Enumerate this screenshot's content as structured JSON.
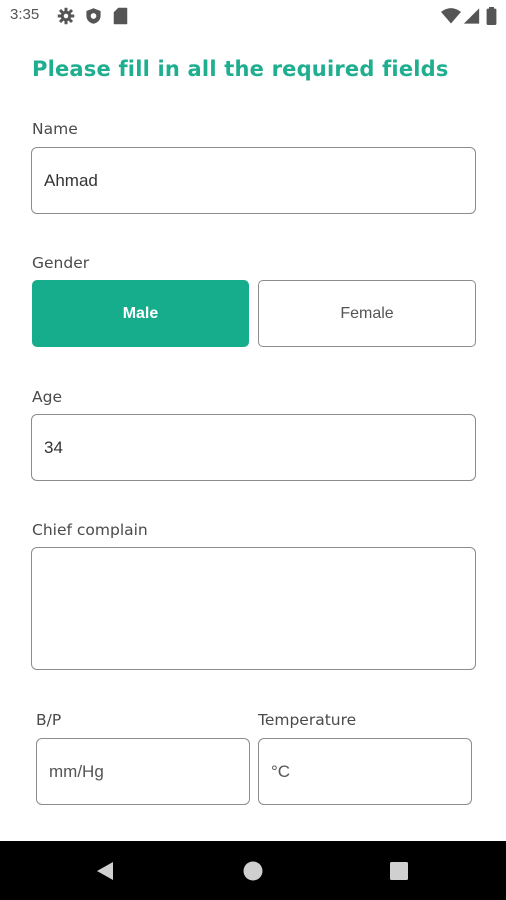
{
  "status_bar": {
    "time": "3:35",
    "icons_left": [
      "settings-icon",
      "shield-icon",
      "sd-card-icon"
    ],
    "icons_right": [
      "wifi-icon",
      "signal-icon",
      "battery-icon"
    ]
  },
  "form": {
    "title": "Please fill in all the required fields",
    "name": {
      "label": "Name",
      "value": "Ahmad"
    },
    "gender": {
      "label": "Gender",
      "options": [
        "Male",
        "Female"
      ],
      "selected": "Male"
    },
    "age": {
      "label": "Age",
      "value": "34"
    },
    "chief_complain": {
      "label": "Chief complain",
      "value": ""
    },
    "bp": {
      "label": "B/P",
      "placeholder": "mm/Hg"
    },
    "temperature": {
      "label": "Temperature",
      "placeholder": "°C"
    }
  },
  "colors": {
    "accent": "#16ad8d",
    "title": "#1fae8f"
  },
  "nav_bar": {
    "icons": [
      "back-icon",
      "home-icon",
      "recents-icon"
    ]
  }
}
